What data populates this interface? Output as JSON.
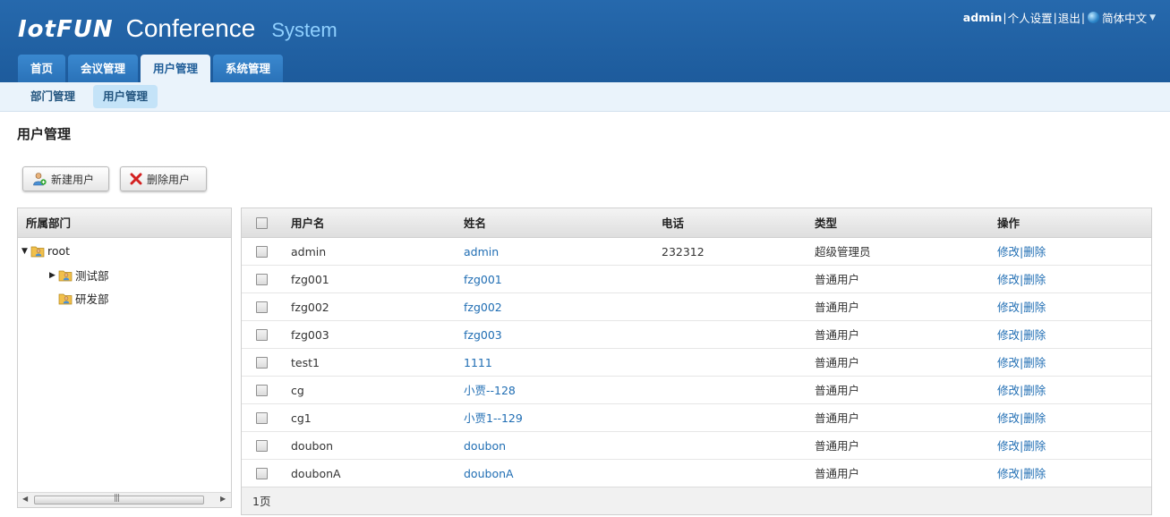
{
  "header": {
    "logo_brand": "IotFUN",
    "logo_conference": "Conference",
    "logo_system": "System",
    "user": "admin",
    "settings_link": "个人设置",
    "logout_link": "退出",
    "language": "简体中文",
    "separator": "|"
  },
  "tabs": [
    "首页",
    "会议管理",
    "用户管理",
    "系统管理"
  ],
  "active_tab": "用户管理",
  "subnav": [
    "部门管理",
    "用户管理"
  ],
  "active_subnav": "用户管理",
  "page_title": "用户管理",
  "toolbar": {
    "new_user": "新建用户",
    "delete_user": "删除用户"
  },
  "tree": {
    "header": "所属部门",
    "root": "root",
    "children": [
      "测试部",
      "研发部"
    ]
  },
  "table": {
    "columns": [
      "用户名",
      "姓名",
      "电话",
      "类型",
      "操作"
    ],
    "rows": [
      {
        "username": "admin",
        "name": "admin",
        "phone": "232312",
        "type": "超级管理员"
      },
      {
        "username": "fzg001",
        "name": "fzg001",
        "phone": "",
        "type": "普通用户"
      },
      {
        "username": "fzg002",
        "name": "fzg002",
        "phone": "",
        "type": "普通用户"
      },
      {
        "username": "fzg003",
        "name": "fzg003",
        "phone": "",
        "type": "普通用户"
      },
      {
        "username": "test1",
        "name": "1111",
        "phone": "",
        "type": "普通用户"
      },
      {
        "username": "cg",
        "name": "小贾--128",
        "phone": "",
        "type": "普通用户"
      },
      {
        "username": "cg1",
        "name": "小贾1--129",
        "phone": "",
        "type": "普通用户"
      },
      {
        "username": "doubon",
        "name": "doubon",
        "phone": "",
        "type": "普通用户"
      },
      {
        "username": "doubonA",
        "name": "doubonA",
        "phone": "",
        "type": "普通用户"
      }
    ],
    "edit_label": "修改",
    "delete_label": "删除",
    "op_separator": "|",
    "footer": "1页"
  },
  "colors": {
    "header_bg": "#1f5f9f",
    "tab_bg": "#3a88cf",
    "subnav_bg": "#eaf3fb",
    "link": "#1f6db3"
  }
}
